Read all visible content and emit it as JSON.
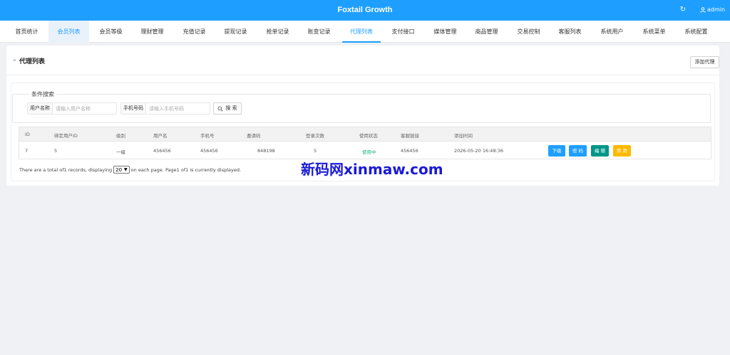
{
  "app": {
    "title": "Foxtail Growth",
    "user": "admin"
  },
  "nav": [
    {
      "label": "首页统计"
    },
    {
      "label": "会员列表"
    },
    {
      "label": "会员等级"
    },
    {
      "label": "理财管理"
    },
    {
      "label": "充值记录"
    },
    {
      "label": "提现记录"
    },
    {
      "label": "抢单记录"
    },
    {
      "label": "账变记录"
    },
    {
      "label": "代理列表"
    },
    {
      "label": "支付接口"
    },
    {
      "label": "媒体管理"
    },
    {
      "label": "商品管理"
    },
    {
      "label": "交易控制"
    },
    {
      "label": "客服列表"
    },
    {
      "label": "系统用户"
    },
    {
      "label": "系统菜单"
    },
    {
      "label": "系统配置"
    }
  ],
  "nav_state": {
    "hover": "会员列表",
    "active": "代理列表"
  },
  "page": {
    "title": "代理列表",
    "add_button": "添加代理"
  },
  "filter": {
    "legend": "条件搜索",
    "username_label": "用户名称",
    "username_placeholder": "请输入用户名称",
    "phone_label": "手机号码",
    "phone_placeholder": "请输入手机号码",
    "search_button": "搜 索"
  },
  "table": {
    "headers": [
      "ID",
      "绑定用户ID",
      "级别",
      "用户名",
      "手机号",
      "邀请码",
      "登录次数",
      "使用状态",
      "客服链接",
      "添加时间"
    ],
    "rows": [
      {
        "id": "7",
        "bind_user_id": "5",
        "level": "一级",
        "username": "456456",
        "phone": "456456",
        "invite_code": "848198",
        "login_count": "5",
        "status": "使用中",
        "service_link": "456456",
        "created": "2026-05-20 16:48:36",
        "actions": [
          "下级",
          "密 码",
          "编 辑",
          "禁 用"
        ]
      }
    ]
  },
  "pager": {
    "prefix": "There are a total of1 records, displaying",
    "page_size": "20",
    "suffix": "on each page. Page1 of1 is currently displayed."
  },
  "watermark": "新码网xinmaw.com",
  "colors": {
    "primary": "#1e9fff",
    "teal": "#009688",
    "warm": "#ffb800",
    "status_green": "#16b777"
  }
}
